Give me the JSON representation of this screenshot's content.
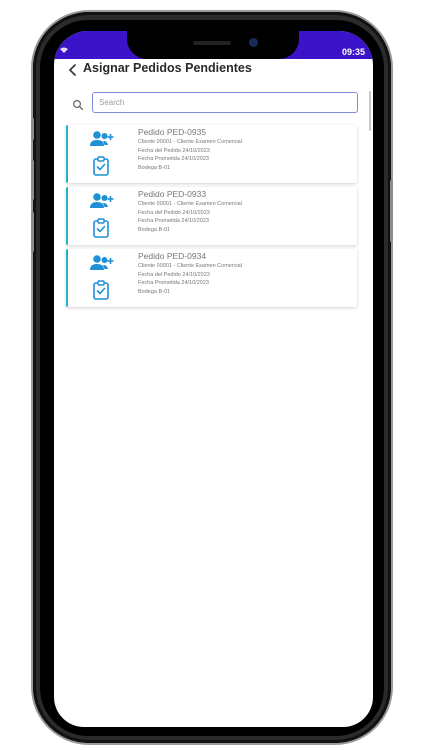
{
  "status_bar": {
    "time": "09:35",
    "indicator_icon": "wifi-icon",
    "background": "#3b13c9"
  },
  "header": {
    "title": "Asignar Pedidos Pendientes",
    "back_icon": "chevron-left-icon"
  },
  "search": {
    "placeholder": "Search",
    "value": ""
  },
  "colors": {
    "accent": "#1e90d6",
    "card_border": "#1fb6c9",
    "text_muted": "#777777"
  },
  "orders": [
    {
      "title": "Pedido PED-0935",
      "client": "Cliente 00001 - Cliente Examen Comercial",
      "order_date": "Fecha del Pedido 24/10/2023",
      "promised_date": "Fecha Prometida 24/10/2023",
      "warehouse": "Bodega B-01"
    },
    {
      "title": "Pedido PED-0933",
      "client": "Cliente 00001 - Cliente Examen Comercial",
      "order_date": "Fecha del Pedido 24/10/2023",
      "promised_date": "Fecha Prometida 24/10/2023",
      "warehouse": "Bodega B-01"
    },
    {
      "title": "Pedido PED-0934",
      "client": "Cliente 00001 - Cliente Examen Comercial",
      "order_date": "Fecha del Pedido 24/10/2023",
      "promised_date": "Fecha Prometida 24/10/2023",
      "warehouse": "Bodega B-01"
    }
  ]
}
